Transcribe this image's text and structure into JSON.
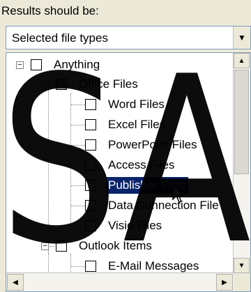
{
  "header": {
    "label": "Results should be:"
  },
  "combo": {
    "value": "Selected file types",
    "arrow_icon": "chevron-down-icon"
  },
  "tree": {
    "items": [
      {
        "label": "Anything",
        "checked": false,
        "expander": "−"
      },
      {
        "label": "Office Files",
        "checked": "partial",
        "expander": "−"
      },
      {
        "label": "Word Files",
        "checked": false
      },
      {
        "label": "Excel Files",
        "checked": false
      },
      {
        "label": "PowerPoint Files",
        "checked": false
      },
      {
        "label": "Access Files",
        "checked": false
      },
      {
        "label": "Publisher Files",
        "checked": true,
        "selected": true
      },
      {
        "label": "Data Connection File",
        "checked": false
      },
      {
        "label": "Visio Files",
        "checked": false
      },
      {
        "label": "Outlook Items",
        "checked": false,
        "expander": "−"
      },
      {
        "label": "E-Mail Messages",
        "checked": false
      }
    ]
  },
  "scrollbars": {
    "up": "▲",
    "down": "▼",
    "left": "◀",
    "right": "▶"
  },
  "watermark": {
    "text": "SA",
    "color": "#000000"
  }
}
